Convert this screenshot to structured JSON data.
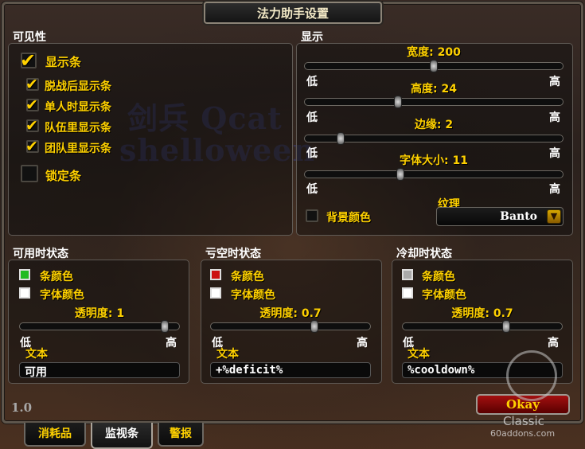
{
  "window": {
    "title": "法力助手设置"
  },
  "watermark": {
    "line1": "剑兵 Qcat",
    "line2": "shelloween"
  },
  "visibility": {
    "header": "可见性",
    "show_bar": {
      "label": "显示条",
      "checked": true
    },
    "after_combat": {
      "label": "脱战后显示条",
      "checked": true
    },
    "solo": {
      "label": "单人时显示条",
      "checked": true
    },
    "party": {
      "label": "队伍里显示条",
      "checked": true
    },
    "raid": {
      "label": "团队里显示条",
      "checked": true
    },
    "lock": {
      "label": "锁定条",
      "checked": false
    }
  },
  "display": {
    "header": "显示",
    "width": {
      "label": "宽度: 200",
      "low": "低",
      "high": "高",
      "value": 200,
      "min": 0,
      "max": 400,
      "fraction": 0.5
    },
    "height": {
      "label": "高度: 24",
      "low": "低",
      "high": "高",
      "value": 24,
      "fraction": 0.36
    },
    "border": {
      "label": "边缘: 2",
      "low": "低",
      "high": "高",
      "value": 2,
      "fraction": 0.14
    },
    "font_size": {
      "label": "字体大小: 11",
      "low": "低",
      "high": "高",
      "value": 11,
      "fraction": 0.37
    },
    "bg_color": {
      "label": "背景颜色",
      "checked": false
    },
    "texture": {
      "label": "纹理",
      "value": "Banto"
    }
  },
  "states": {
    "ready": {
      "header": "可用时状态",
      "bar_color_label": "条颜色",
      "bar_color": "#22bb22",
      "font_color_label": "字体颜色",
      "font_color": "#ffffff",
      "alpha_label": "透明度: 1",
      "alpha_fraction": 1.0,
      "low": "低",
      "high": "高",
      "text_label": "文本",
      "text_value": "可用"
    },
    "deficit": {
      "header": "亏空时状态",
      "bar_color_label": "条颜色",
      "bar_color": "#cc1111",
      "font_color_label": "字体颜色",
      "font_color": "#ffffff",
      "alpha_label": "透明度: 0.7",
      "alpha_fraction": 0.7,
      "low": "低",
      "high": "高",
      "text_label": "文本",
      "text_value": "+%deficit%"
    },
    "cooldown": {
      "header": "冷却时状态",
      "bar_color_label": "条颜色",
      "bar_color": "#aaaaaa",
      "font_color_label": "字体颜色",
      "font_color": "#ffffff",
      "alpha_label": "透明度: 0.7",
      "alpha_fraction": 0.7,
      "low": "低",
      "high": "高",
      "text_label": "文本",
      "text_value": "%cooldown%"
    }
  },
  "footer": {
    "version": "1.0",
    "okay_label": "Okay"
  },
  "tabs": [
    {
      "label": "消耗品",
      "active": false
    },
    {
      "label": "监视条",
      "active": true
    },
    {
      "label": "警报",
      "active": false
    }
  ],
  "logo": {
    "line1": "Classic",
    "line2": "60addons.com"
  }
}
